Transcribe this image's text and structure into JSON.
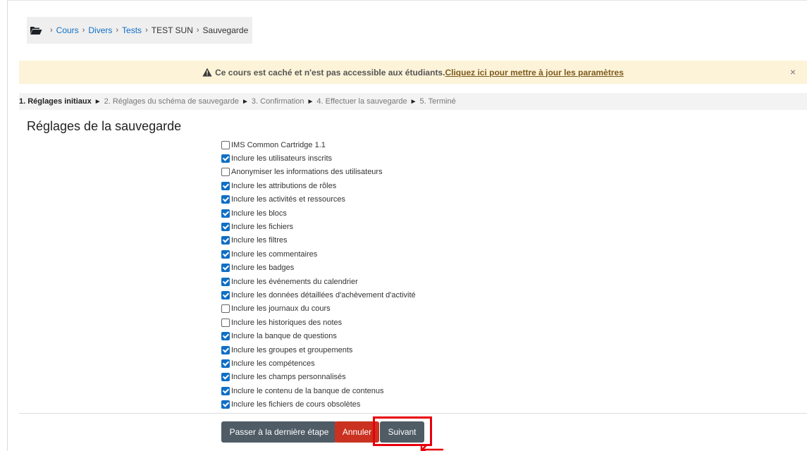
{
  "breadcrumb": {
    "items": [
      {
        "label": "Cours",
        "link": true
      },
      {
        "label": "Divers",
        "link": true
      },
      {
        "label": "Tests",
        "link": true
      },
      {
        "label": "TEST SUN",
        "link": false
      },
      {
        "label": "Sauvegarde",
        "link": false
      }
    ],
    "separator": "›"
  },
  "alert": {
    "message": "Ce cours est caché et n'est pas accessible aux étudiants.",
    "link": "Cliquez ici pour mettre à jour les paramètres",
    "close": "×"
  },
  "progress": {
    "steps": [
      "1. Réglages initiaux",
      "2. Réglages du schéma de sauvegarde",
      "3. Confirmation",
      "4. Effectuer la sauvegarde",
      "5. Terminé"
    ],
    "arrow": "►"
  },
  "heading": "Réglages de la sauvegarde",
  "options": [
    {
      "label": "IMS Common Cartridge 1.1",
      "checked": false
    },
    {
      "label": "Inclure les utilisateurs inscrits",
      "checked": true
    },
    {
      "label": "Anonymiser les informations des utilisateurs",
      "checked": false
    },
    {
      "label": "Inclure les attributions de rôles",
      "checked": true
    },
    {
      "label": "Inclure les activités et ressources",
      "checked": true
    },
    {
      "label": "Inclure les blocs",
      "checked": true
    },
    {
      "label": "Inclure les fichiers",
      "checked": true
    },
    {
      "label": "Inclure les filtres",
      "checked": true
    },
    {
      "label": "Inclure les commentaires",
      "checked": true
    },
    {
      "label": "Inclure les badges",
      "checked": true
    },
    {
      "label": "Inclure les événements du calendrier",
      "checked": true
    },
    {
      "label": "Inclure les données détaillées d'achèvement d'activité",
      "checked": true
    },
    {
      "label": "Inclure les journaux du cours",
      "checked": false
    },
    {
      "label": "Inclure les historiques des notes",
      "checked": false
    },
    {
      "label": "Inclure la banque de questions",
      "checked": true
    },
    {
      "label": "Inclure les groupes et groupements",
      "checked": true
    },
    {
      "label": "Inclure les compétences",
      "checked": true
    },
    {
      "label": "Inclure les champs personnalisés",
      "checked": true
    },
    {
      "label": "Inclure le contenu de la banque de contenus",
      "checked": true
    },
    {
      "label": "Inclure les fichiers de cours obsolètes",
      "checked": true
    }
  ],
  "buttons": {
    "skip": "Passer à la dernière étape",
    "cancel": "Annuler",
    "next": "Suivant"
  },
  "colors": {
    "link": "#0f6fc5",
    "primary_button": "#4f5c66",
    "cancel_button": "#ca3120",
    "highlight": "#e8000b",
    "alert_bg": "#fcf3d8"
  },
  "icons": {
    "breadcrumb_home": "folder-open-icon",
    "alert": "warning-triangle-icon",
    "annotation": "pointer-arrow-icon"
  }
}
